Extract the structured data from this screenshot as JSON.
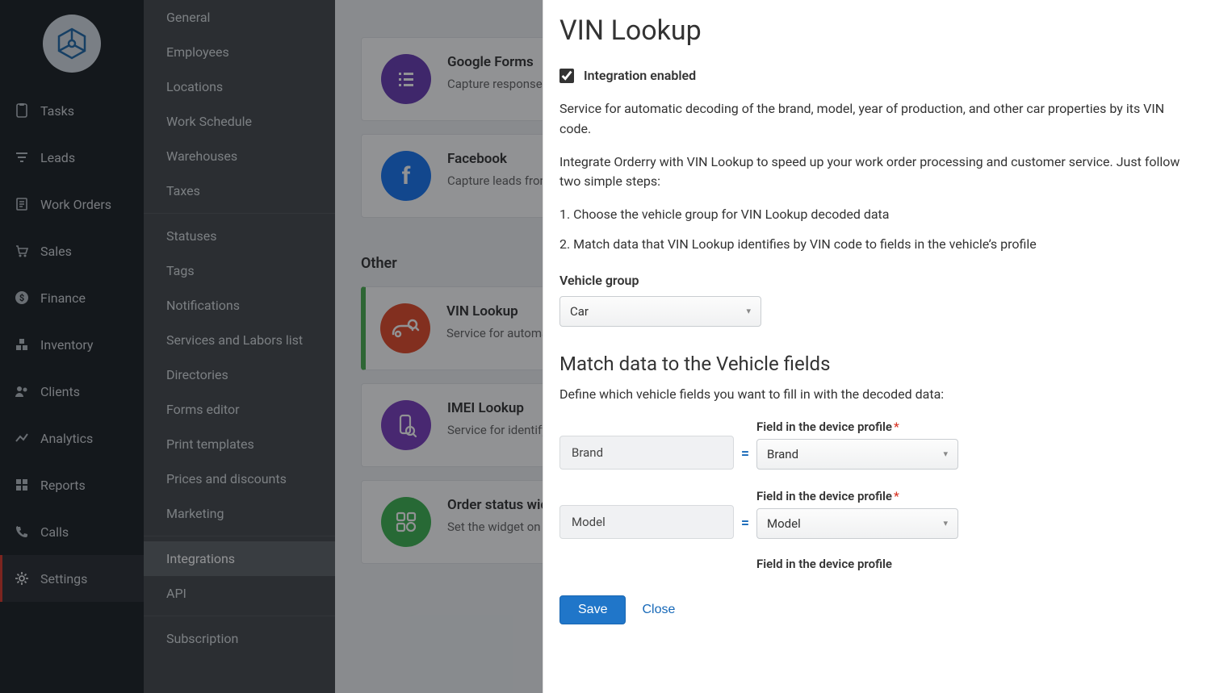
{
  "main_nav": {
    "items": [
      {
        "key": "tasks",
        "label": "Tasks"
      },
      {
        "key": "leads",
        "label": "Leads"
      },
      {
        "key": "work-orders",
        "label": "Work Orders"
      },
      {
        "key": "sales",
        "label": "Sales"
      },
      {
        "key": "finance",
        "label": "Finance"
      },
      {
        "key": "inventory",
        "label": "Inventory"
      },
      {
        "key": "clients",
        "label": "Clients"
      },
      {
        "key": "analytics",
        "label": "Analytics"
      },
      {
        "key": "reports",
        "label": "Reports"
      },
      {
        "key": "calls",
        "label": "Calls"
      },
      {
        "key": "settings",
        "label": "Settings"
      }
    ],
    "active": "settings"
  },
  "settings_menu": {
    "groups": [
      [
        "General",
        "Employees",
        "Locations",
        "Work Schedule",
        "Warehouses",
        "Taxes"
      ],
      [
        "Statuses",
        "Tags",
        "Notifications",
        "Services and Labors list",
        "Directories",
        "Forms editor",
        "Print templates",
        "Prices and discounts",
        "Marketing"
      ],
      [
        "Integrations",
        "API"
      ],
      [
        "Subscription"
      ]
    ],
    "active": "Integrations"
  },
  "content": {
    "cards_top": [
      {
        "title": "Google Forms",
        "desc": "Capture response Orderry",
        "color": "#6a3db5"
      },
      {
        "title": "Facebook",
        "desc": "Capture leads from",
        "color": "#1877f2"
      }
    ],
    "section_other": "Other",
    "cards_other": [
      {
        "title": "VIN Lookup",
        "desc": "Service for automatic VIN code.",
        "color": "#e34b2a",
        "selected": true
      },
      {
        "title": "IMEI Lookup",
        "desc": "Service for identifying",
        "color": "#7b3fbf"
      },
      {
        "title": "Order status widget",
        "desc": "Set the widget on entering their phone",
        "color": "#3fb553"
      }
    ]
  },
  "modal": {
    "title": "VIN Lookup",
    "checkbox_label": "Integration enabled",
    "checkbox_checked": true,
    "desc1": "Service for automatic decoding of the brand, model, year of production, and other car properties by its VIN code.",
    "desc2": "Integrate Orderry with VIN Lookup to speed up your work order processing and customer service. Just follow two simple steps:",
    "step1": "1. Choose the vehicle group for VIN Lookup decoded data",
    "step2": "2. Match data that VIN Lookup identifies by VIN code to fields in the vehicle’s profile",
    "vehicle_group_label": "Vehicle group",
    "vehicle_group_value": "Car",
    "match_heading": "Match data to the Vehicle fields",
    "match_desc": "Define which vehicle fields you want to fill in with the decoded data:",
    "field_label": "Field in the device profile",
    "required_mark": "*",
    "rows": [
      {
        "source": "Brand",
        "target": "Brand"
      },
      {
        "source": "Model",
        "target": "Model"
      }
    ],
    "trailing_label": "Field in the device profile",
    "save": "Save",
    "close": "Close",
    "equals": "="
  }
}
